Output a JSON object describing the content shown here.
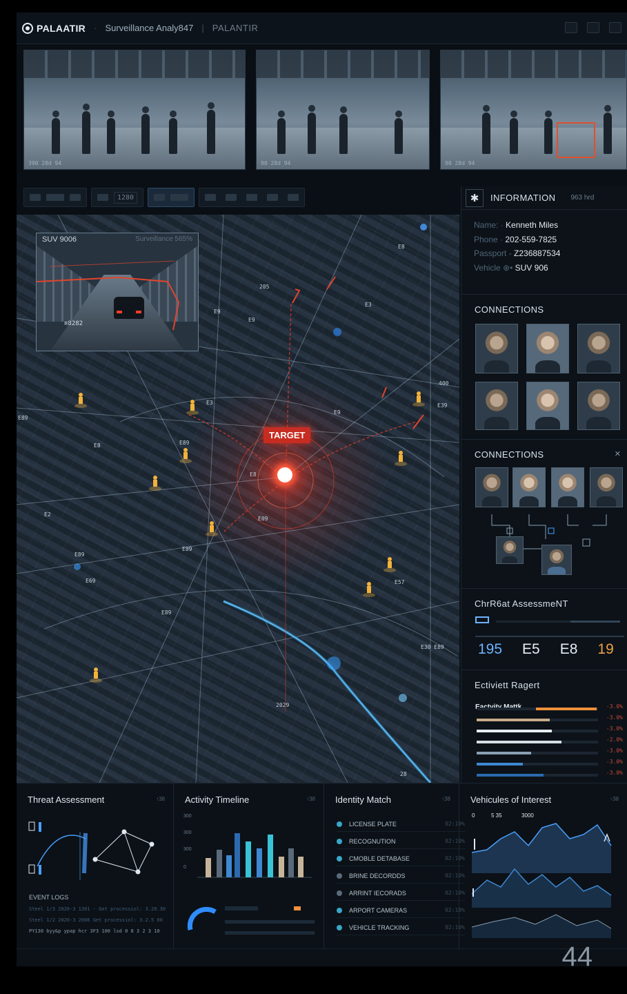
{
  "header": {
    "brand": "PALAATIR",
    "title": "Surveillance Analy847",
    "subtitle": "PALANTIR"
  },
  "feeds": [
    {
      "label": "390 28d 94"
    },
    {
      "label": "90 28d 94"
    },
    {
      "label": "90 28d 94"
    }
  ],
  "toolbar": {
    "zoom": "1280"
  },
  "map": {
    "inset_title": "SUV 9006",
    "inset_meta": "Surveillance 565%",
    "inset_plate": "≡8282",
    "target_label": "TARGET"
  },
  "info": {
    "title": "INFORMATION",
    "meta": "963 hrd",
    "rows": [
      {
        "k": "Name: ·",
        "v": "Kenneth Miles"
      },
      {
        "k": "Phone ·",
        "v": "202-559-7825"
      },
      {
        "k": "Passport -",
        "v": "Z236887534"
      },
      {
        "k": "Vehicle  ⊕•",
        "v": "SUV 906"
      }
    ]
  },
  "connections1": {
    "title": "CONNECTIONS"
  },
  "connections2": {
    "title": "CONNECTIONS"
  },
  "chr": {
    "title": "ChrR6at AssessmeNT",
    "stats": [
      "195",
      "E5",
      "E8",
      "19"
    ]
  },
  "activity": {
    "title": "Ectiviett Ragert",
    "first_label": "Eactvity Mattk",
    "bars": [
      {
        "val": "-3.0%",
        "fill": 0.5,
        "color": "#f0903a"
      },
      {
        "val": "-3.0%",
        "fill": 0.6,
        "color": "#c7aa8a"
      },
      {
        "val": "-3.0%",
        "fill": 0.62,
        "color": "#e6edf3"
      },
      {
        "val": "-2.0%",
        "fill": 0.7,
        "color": "#d6dde4"
      },
      {
        "val": "-3.0%",
        "fill": 0.45,
        "color": "#8aa0b4"
      },
      {
        "val": "-3.0%",
        "fill": 0.38,
        "color": "#3e88d2"
      },
      {
        "val": "-3.0%",
        "fill": 0.55,
        "color": "#2c6ab0"
      }
    ]
  },
  "bottom": {
    "threat": {
      "title": "Threat Assessment",
      "meta": "↑38"
    },
    "event_logs": "EVENT LOGS",
    "logs": [
      "Steel 1/3 2020-3 1301 · Get processiol: 3.20.30",
      "Steel 1/2 2020-3 2006     Get processiol: 3.2.5 00",
      "PY130 byy&p ypap hcr  3F3 100 lsd 0 8 3 2 3 10"
    ],
    "timeline": {
      "title": "Activity Timeline",
      "meta": "↑38",
      "yticks": [
        "300",
        "300",
        "300",
        "0"
      ]
    },
    "identity": {
      "title": "Identity Match",
      "meta": "↑38",
      "rows": [
        {
          "label": "LICENSE PLATE",
          "time": "02:10%"
        },
        {
          "label": "RECOGNUTION",
          "time": "02:10%"
        },
        {
          "label": "CMOBLE DETABASE",
          "time": "02:10%"
        },
        {
          "label": "BRINE DECORDDS",
          "time": "02:10%"
        },
        {
          "label": "ARRINT IECORADS",
          "time": "02:10%"
        },
        {
          "label": "ARPORT CAMERAS",
          "time": "02:10%"
        },
        {
          "label": "VEHICLE TRACKING",
          "time": "02:10%"
        }
      ]
    },
    "vehicles": {
      "title": "Vehicules of Interest",
      "meta": "↑38",
      "axis": [
        "0",
        "5 35",
        "3000"
      ]
    }
  },
  "page_number": "44"
}
